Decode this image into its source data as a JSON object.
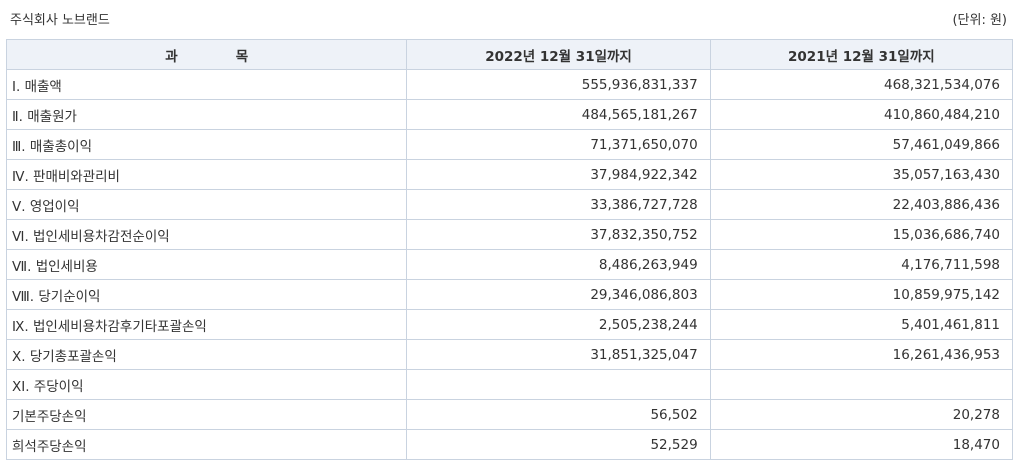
{
  "header": {
    "company": "주식회사 노브랜드",
    "unit": "(단위: 원)"
  },
  "table": {
    "columns": {
      "subject_part1": "과",
      "subject_part2": "목",
      "current": "2022년 12월 31일까지",
      "prior": "2021년 12월 31일까지"
    },
    "rows": [
      {
        "item": "Ⅰ. 매출액",
        "current": "555,936,831,337",
        "prior": "468,321,534,076"
      },
      {
        "item": "Ⅱ. 매출원가",
        "current": "484,565,181,267",
        "prior": "410,860,484,210"
      },
      {
        "item": "Ⅲ. 매출총이익",
        "current": "71,371,650,070",
        "prior": "57,461,049,866"
      },
      {
        "item": "Ⅳ. 판매비와관리비",
        "current": "37,984,922,342",
        "prior": "35,057,163,430"
      },
      {
        "item": "Ⅴ. 영업이익",
        "current": "33,386,727,728",
        "prior": "22,403,886,436"
      },
      {
        "item": "Ⅵ. 법인세비용차감전순이익",
        "current": "37,832,350,752",
        "prior": "15,036,686,740"
      },
      {
        "item": "Ⅶ. 법인세비용",
        "current": "8,486,263,949",
        "prior": "4,176,711,598"
      },
      {
        "item": "Ⅷ. 당기순이익",
        "current": "29,346,086,803",
        "prior": "10,859,975,142"
      },
      {
        "item": "Ⅸ. 법인세비용차감후기타포괄손익",
        "current": "2,505,238,244",
        "prior": "5,401,461,811"
      },
      {
        "item": "Ⅹ. 당기총포괄손익",
        "current": "31,851,325,047",
        "prior": "16,261,436,953"
      },
      {
        "item": "XI. 주당이익",
        "current": "",
        "prior": ""
      },
      {
        "item": "기본주당손익",
        "current": "56,502",
        "prior": "20,278"
      },
      {
        "item": "희석주당손익",
        "current": "52,529",
        "prior": "18,470"
      }
    ]
  }
}
